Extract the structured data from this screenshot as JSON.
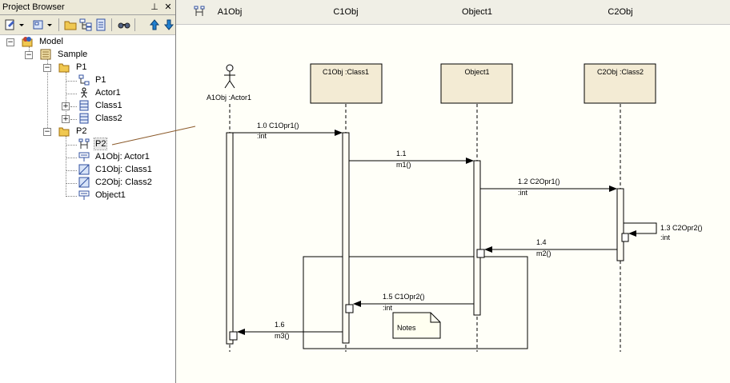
{
  "project_browser": {
    "title": "Project Browser",
    "pin_glyph": "⊥",
    "close_glyph": "✕",
    "tree": {
      "model": "Model",
      "sample": "Sample",
      "p1_package": "P1",
      "p1_diagram": "P1",
      "actor1": "Actor1",
      "class1": "Class1",
      "class2": "Class2",
      "p2_package": "P2",
      "p2_diagram": "P2",
      "a1obj": "A1Obj: Actor1",
      "c1obj": "C1Obj: Class1",
      "c2obj": "C2Obj: Class2",
      "object1": "Object1"
    }
  },
  "diagram": {
    "header_labels": [
      "A1Obj",
      "C1Obj",
      "Object1",
      "C2Obj"
    ],
    "actor_label": "A1Obj :Actor1",
    "lifelines": {
      "c1obj": "C1Obj :Class1",
      "object1": "Object1",
      "c2obj": "C2Obj :Class2"
    },
    "messages": {
      "m10": "1.0 C1Opr1()",
      "m10_ret": ":int",
      "m11": "1.1",
      "m11_op": "m1()",
      "m12": "1.2 C2Opr1()",
      "m12_ret": ":int",
      "m13": "1.3 C2Opr2()",
      "m13_ret": ":int",
      "m14": "1.4",
      "m14_op": "m2()",
      "m15": "1.5 C1Opr2()",
      "m15_ret": ":int",
      "m16": "1.6",
      "m16_op": "m3()"
    },
    "note": "Notes"
  },
  "colors": {
    "lifeline_box": "#f3ebd4",
    "diagram_bg": "#fffff8",
    "panel_bg": "#ece9d8"
  }
}
